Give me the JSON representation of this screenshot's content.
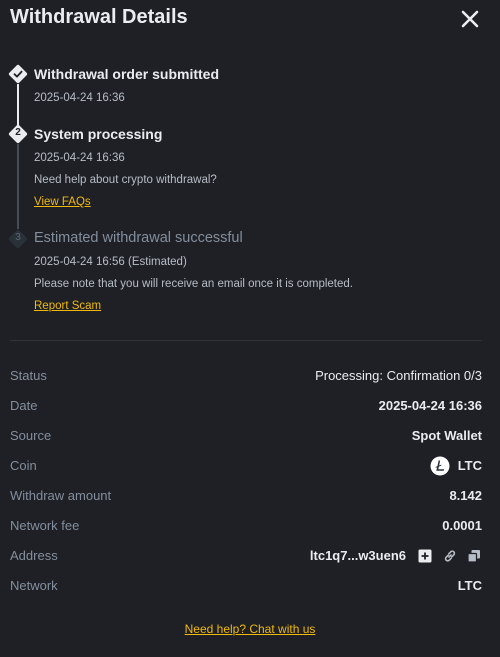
{
  "header": {
    "title": "Withdrawal Details"
  },
  "steps": [
    {
      "title": "Withdrawal order submitted",
      "time": "2025-04-24 16:36",
      "status": "done"
    },
    {
      "number": "2",
      "title": "System processing",
      "time": "2025-04-24 16:36",
      "note": "Need help about crypto withdrawal?",
      "link": "View FAQs",
      "status": "active"
    },
    {
      "number": "3",
      "title": "Estimated withdrawal successful",
      "time": "2025-04-24 16:56 (Estimated)",
      "note": "Please note that you will receive an email once it is completed.",
      "link": "Report Scam",
      "status": "pending"
    }
  ],
  "details": {
    "status_label": "Status",
    "status_value": "Processing: Confirmation 0/3",
    "date_label": "Date",
    "date_value": "2025-04-24 16:36",
    "source_label": "Source",
    "source_value": "Spot Wallet",
    "coin_label": "Coin",
    "coin_value": "LTC",
    "amount_label": "Withdraw amount",
    "amount_value": "8.142",
    "fee_label": "Network fee",
    "fee_value": "0.0001",
    "address_label": "Address",
    "address_value": "ltc1q7...w3uen6",
    "network_label": "Network",
    "network_value": "LTC"
  },
  "footer": {
    "help_link": "Need help? Chat with us"
  },
  "colors": {
    "background": "#1e2026",
    "accent": "#f0b90b",
    "muted": "#848e9c",
    "text": "#eaecef"
  },
  "icons": {
    "close": "close-icon",
    "step1": "check-icon",
    "coin": "litecoin-icon",
    "address_actions": [
      "qr-code-icon",
      "link-icon",
      "copy-icon"
    ]
  }
}
